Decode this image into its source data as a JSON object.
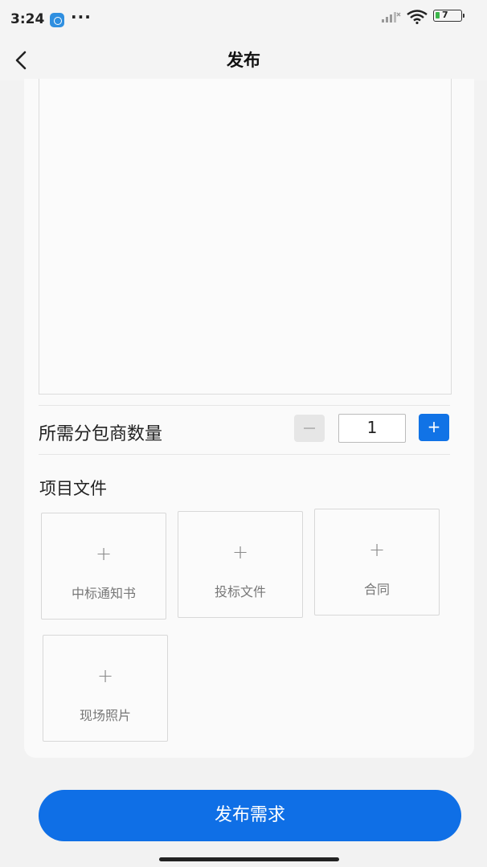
{
  "status_bar": {
    "time": "3:24",
    "more": "···",
    "battery_level": "7"
  },
  "nav": {
    "title": "发布"
  },
  "form": {
    "subcontractor_count_label": "所需分包商数量",
    "subcontractor_count_value": "1",
    "minus_label": "−",
    "plus_label": "+",
    "files_title": "项目文件",
    "uploads": [
      {
        "plus": "+",
        "label": "中标通知书"
      },
      {
        "plus": "+",
        "label": "投标文件"
      },
      {
        "plus": "+",
        "label": "合同"
      },
      {
        "plus": "+",
        "label": "现场照片"
      }
    ]
  },
  "submit": {
    "label": "发布需求"
  },
  "colors": {
    "primary": "#0f6fe6",
    "background": "#f2f2f2",
    "card": "#fafafa"
  }
}
